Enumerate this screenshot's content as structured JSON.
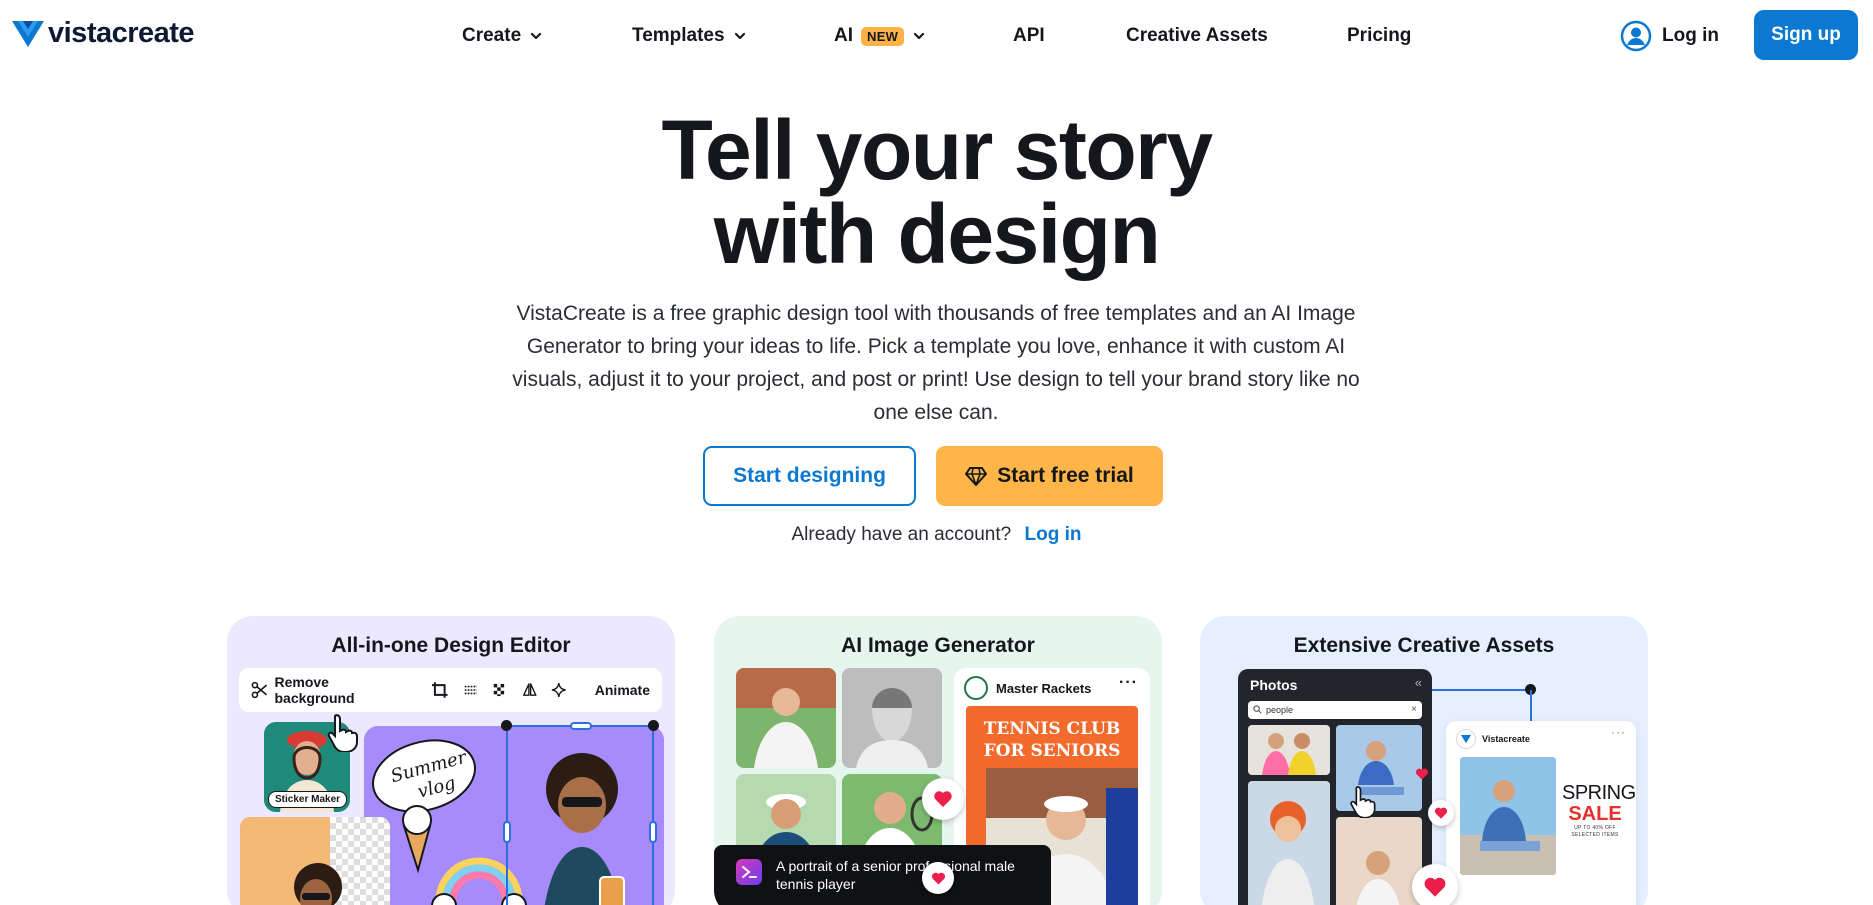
{
  "header": {
    "logo_text": "vistacreate",
    "nav": [
      {
        "label": "Create",
        "has_dropdown": true
      },
      {
        "label": "Templates",
        "has_dropdown": true
      },
      {
        "label": "AI",
        "badge": "NEW",
        "has_dropdown": true
      },
      {
        "label": "API",
        "has_dropdown": false
      },
      {
        "label": "Creative Assets",
        "has_dropdown": false
      },
      {
        "label": "Pricing",
        "has_dropdown": false
      }
    ],
    "login_label": "Log in",
    "signup_label": "Sign up",
    "icons": {
      "user": "user-circle-icon",
      "chevron": "chevron-down-icon"
    }
  },
  "hero": {
    "title_line1": "Tell your story",
    "title_line2": "with design",
    "description": "VistaCreate is a free graphic design tool with thousands of free templates and an AI Image Generator to bring your ideas to life. Pick a template you love, enhance it with custom AI visuals, adjust it to your project, and post or print! Use design to tell your brand story like no one else can.",
    "primary_button": "Start designing",
    "trial_button": "Start free trial",
    "account_prompt": "Already have an account?",
    "account_link": "Log in"
  },
  "cards": [
    {
      "title": "All-in-one Design Editor",
      "toolbar": {
        "remove_bg_label": "Remove background",
        "animate_label": "Animate",
        "tool_icons": [
          "scissors-icon",
          "crop-icon",
          "adjust-icon",
          "transparency-icon",
          "flip-icon",
          "sparkle-icon"
        ]
      },
      "sticker_label": "Sticker Maker"
    },
    {
      "title": "AI Image Generator",
      "post_brand": "Master Rackets",
      "poster_title": "TENNIS CLUB FOR SENIORS",
      "prompt_text": "A portrait of a senior professional male tennis player"
    },
    {
      "title": "Extensive Creative Assets",
      "panel_title": "Photos",
      "search_value": "people",
      "ig_brand": "Vistacreate",
      "promo_line1": "SPRING",
      "promo_line2": "SALE",
      "promo_line3": "UP TO 40% OFF",
      "promo_line4": "SELECTED ITEMS"
    }
  ],
  "colors": {
    "brand_blue": "#0b78d1",
    "trial_orange": "#ffb547",
    "badge_orange": "#ffb347",
    "card_purple": "#ece9fe",
    "card_green": "#e6f6ee",
    "card_blue": "#e5effd"
  }
}
